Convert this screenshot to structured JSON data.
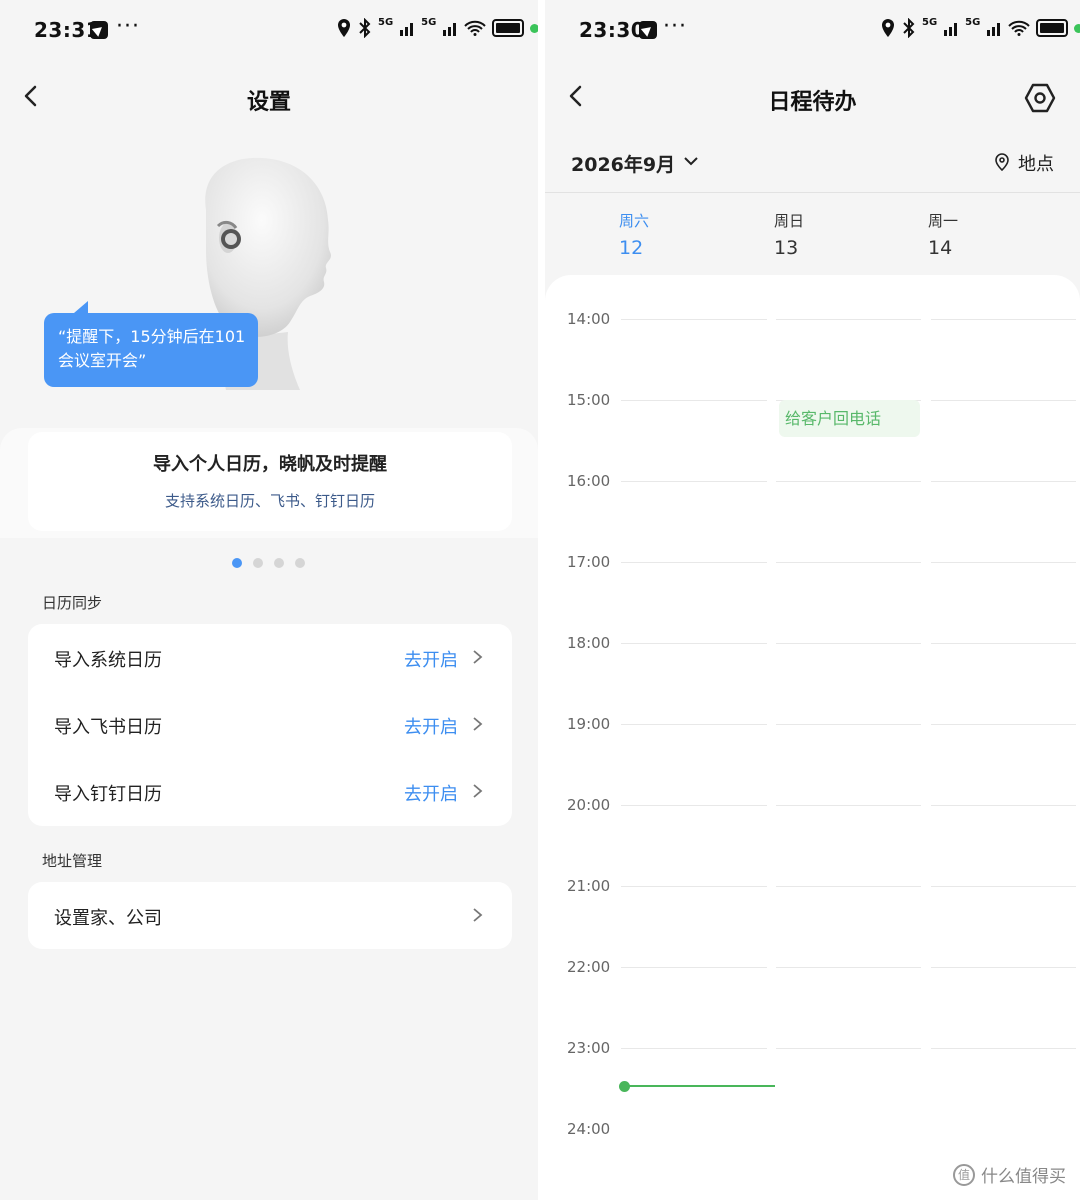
{
  "left": {
    "status": {
      "time": "23:31",
      "dots": "···",
      "net_a": "5G",
      "net_b": "5G"
    },
    "title": "设置",
    "bubble": {
      "line1": "“提醒下，15分钟后在101",
      "line2": "会议室开会”"
    },
    "promo": {
      "title": "导入个人日历，晓帆及时提醒",
      "subtitle": "支持系统日历、飞书、钉钉日历"
    },
    "pager": {
      "count": 4,
      "active_index": 0
    },
    "calendar_sync": {
      "label": "日历同步",
      "items": [
        {
          "label": "导入系统日历",
          "action": "去开启"
        },
        {
          "label": "导入飞书日历",
          "action": "去开启"
        },
        {
          "label": "导入钉钉日历",
          "action": "去开启"
        }
      ]
    },
    "address": {
      "label": "地址管理",
      "items": [
        {
          "label": "设置家、公司"
        }
      ]
    }
  },
  "right": {
    "status": {
      "time": "23:30",
      "dots": "···",
      "net_a": "5G",
      "net_b": "5G"
    },
    "title": "日程待办",
    "month": "2026年9月",
    "location": "地点",
    "days": [
      {
        "name": "周六",
        "num": "12",
        "active": true
      },
      {
        "name": "周日",
        "num": "13",
        "active": false
      },
      {
        "name": "周一",
        "num": "14",
        "active": false
      }
    ],
    "hours": [
      "14:00",
      "15:00",
      "16:00",
      "17:00",
      "18:00",
      "19:00",
      "20:00",
      "21:00",
      "22:00",
      "23:00",
      "24:00"
    ],
    "event": {
      "title": "给客户回电话",
      "start": "15:00",
      "day": "周日"
    }
  },
  "watermark": {
    "text": "什么值得买",
    "logo": "值"
  },
  "colors": {
    "accent": "#3d8ef0",
    "bubble": "#4a96f5",
    "event_bg": "#eef8ee",
    "event_text": "#58b86a",
    "now": "#49b65a"
  }
}
